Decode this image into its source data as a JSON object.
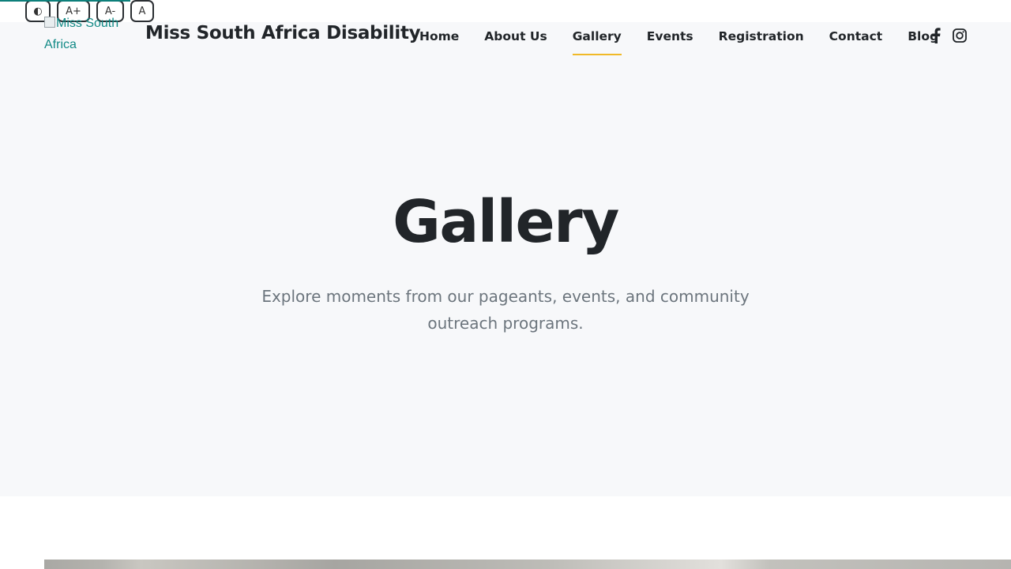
{
  "accessibility": {
    "contrast_label": "◐",
    "increase_label": "A+",
    "decrease_label": "A-",
    "reset_label": "A"
  },
  "header": {
    "logo_alt": "Miss South Africa",
    "brand_name": "Miss South Africa Disability",
    "nav_items": [
      {
        "label": "Home",
        "active": false
      },
      {
        "label": "About Us",
        "active": false
      },
      {
        "label": "Gallery",
        "active": true
      },
      {
        "label": "Events",
        "active": false
      },
      {
        "label": "Registration",
        "active": false
      },
      {
        "label": "Contact",
        "active": false
      },
      {
        "label": "Blog",
        "active": false
      }
    ],
    "social_icons": [
      "facebook-icon",
      "instagram-icon"
    ]
  },
  "hero": {
    "title": "Gallery",
    "subtitle": "Explore moments from our pageants, events, and community outreach programs."
  },
  "colors": {
    "accent_teal": "#0d7f7a",
    "nav_active_underline": "#f0b928",
    "hero_background": "#f7f8fa",
    "text_dark": "#212529",
    "text_muted": "#6c757d"
  }
}
